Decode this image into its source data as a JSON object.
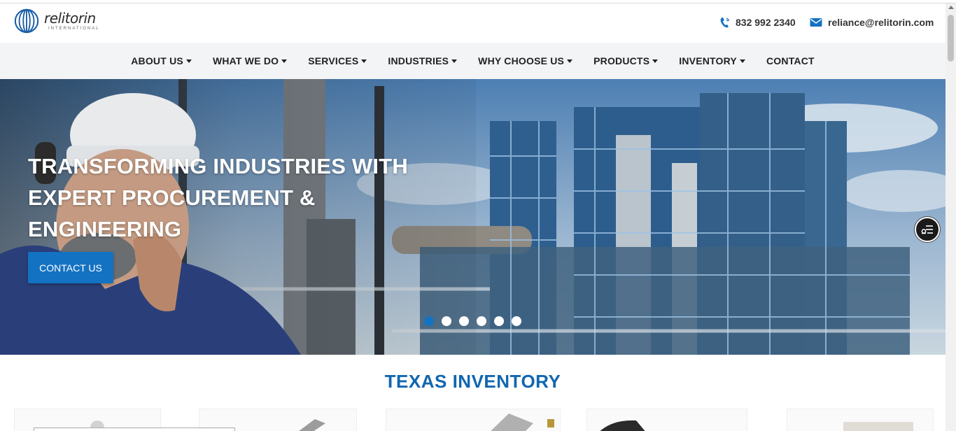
{
  "brand": {
    "name": "relitorin",
    "subline": "INTERNATIONAL"
  },
  "contact": {
    "phone": "832 992 2340",
    "email": "reliance@relitorin.com"
  },
  "nav": {
    "items": [
      {
        "label": "ABOUT US",
        "dropdown": true
      },
      {
        "label": "WHAT WE DO",
        "dropdown": true
      },
      {
        "label": "SERVICES",
        "dropdown": true
      },
      {
        "label": "INDUSTRIES",
        "dropdown": true
      },
      {
        "label": "WHY CHOOSE US",
        "dropdown": true
      },
      {
        "label": "PRODUCTS",
        "dropdown": true
      },
      {
        "label": "INVENTORY",
        "dropdown": true
      },
      {
        "label": "CONTACT",
        "dropdown": false
      }
    ]
  },
  "hero": {
    "title_lines": [
      "TRANSFORMING INDUSTRIES WITH",
      "EXPERT PROCUREMENT &",
      "ENGINEERING"
    ],
    "cta_label": "CONTACT US",
    "slide_count": 6,
    "active_slide": 1
  },
  "section": {
    "title": "TEXAS INVENTORY"
  },
  "colors": {
    "brand_blue": "#1472c2",
    "heading_blue": "#1166b0",
    "nav_bg": "#f3f4f6"
  },
  "icons": {
    "phone": "phone-icon",
    "email": "envelope-icon",
    "tool": "settings-sliders-icon"
  }
}
